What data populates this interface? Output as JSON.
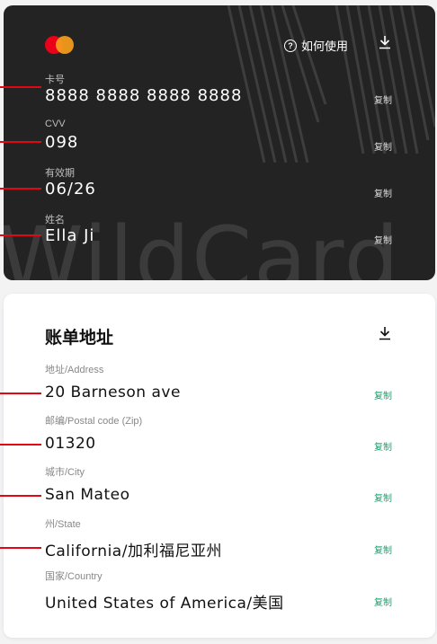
{
  "card": {
    "howto_label": "如何使用",
    "watermark": "WildCard",
    "fields": [
      {
        "label": "卡号",
        "value": "8888 8888 8888 8888",
        "copy": "复制"
      },
      {
        "label": "CVV",
        "value": "098",
        "copy": "复制"
      },
      {
        "label": "有效期",
        "value": "06/26",
        "copy": "复制"
      },
      {
        "label": "姓名",
        "value": "Ella Ji",
        "copy": "复制"
      }
    ],
    "colors": {
      "background": "#232323",
      "mastercard_red": "#ea001b",
      "mastercard_orange": "#f79e1b",
      "marker": "#e30613"
    }
  },
  "billing": {
    "title": "账单地址",
    "fields": [
      {
        "label": "地址/Address",
        "value": "20 Barneson ave",
        "copy": "复制"
      },
      {
        "label": "邮编/Postal code (Zip)",
        "value": "01320",
        "copy": "复制"
      },
      {
        "label": "城市/City",
        "value": "San Mateo",
        "copy": "复制"
      },
      {
        "label": "州/State",
        "value": "California/加利福尼亚州",
        "copy": "复制"
      },
      {
        "label": "国家/Country",
        "value": "United States of America/美国",
        "copy": "复制"
      }
    ],
    "colors": {
      "copy": "#1aa36b"
    }
  },
  "icons": [
    "mastercard-logo",
    "question-circle-icon",
    "download-icon"
  ]
}
